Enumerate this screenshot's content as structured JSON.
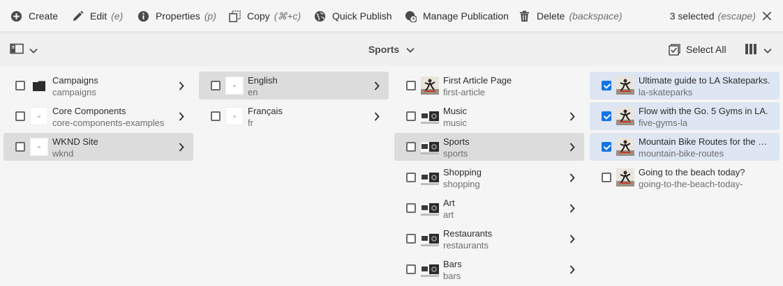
{
  "actionbar": {
    "create": "Create",
    "edit": "Edit",
    "edit_key": "(e)",
    "properties": "Properties",
    "properties_key": "(p)",
    "copy": "Copy",
    "copy_key": "(⌘+c)",
    "quick_publish": "Quick Publish",
    "manage_publication": "Manage Publication",
    "delete": "Delete",
    "delete_key": "(backspace)",
    "selected": "3 selected",
    "selected_key": "(escape)"
  },
  "toolbar": {
    "title": "Sports",
    "select_all": "Select All"
  },
  "colors": {
    "accent": "#1473e6",
    "highlight": "#dcdcdc",
    "selected": "#dde6f2"
  },
  "columns": [
    {
      "items": [
        {
          "title": "Campaigns",
          "name": "campaigns",
          "icon": "folder-icon"
        },
        {
          "title": "Core Components",
          "name": "core-components-examples",
          "icon": "page-thumbnail"
        },
        {
          "title": "WKND Site",
          "name": "wknd",
          "icon": "page-thumbnail"
        }
      ]
    },
    {
      "items": [
        {
          "title": "English",
          "name": "en",
          "icon": "page-thumbnail"
        },
        {
          "title": "Français",
          "name": "fr",
          "icon": "page-thumbnail"
        }
      ]
    },
    {
      "items": [
        {
          "title": "First Article Page",
          "name": "first-article",
          "icon": "skater-thumbnail"
        },
        {
          "title": "Music",
          "name": "music",
          "icon": "camera-thumbnail"
        },
        {
          "title": "Sports",
          "name": "sports",
          "icon": "camera-thumbnail"
        },
        {
          "title": "Shopping",
          "name": "shopping",
          "icon": "camera-thumbnail"
        },
        {
          "title": "Art",
          "name": "art",
          "icon": "camera-thumbnail"
        },
        {
          "title": "Restaurants",
          "name": "restaurants",
          "icon": "camera-thumbnail"
        },
        {
          "title": "Bars",
          "name": "bars",
          "icon": "camera-thumbnail"
        }
      ]
    },
    {
      "items": [
        {
          "title": "Ultimate guide to LA Skateparks.",
          "name": "la-skateparks",
          "icon": "skater-thumbnail"
        },
        {
          "title": "Flow with the Go. 5 Gyms in LA.",
          "name": "five-gyms-la",
          "icon": "skater-thumbnail"
        },
        {
          "title": "Mountain Bike Routes for the Mountain Bike Routes",
          "name": "mountain-bike-routes",
          "icon": "skater-thumbnail"
        },
        {
          "title": "Going to the beach today?",
          "name": "going-to-the-beach-today-",
          "icon": "skater-thumbnail"
        }
      ]
    }
  ]
}
